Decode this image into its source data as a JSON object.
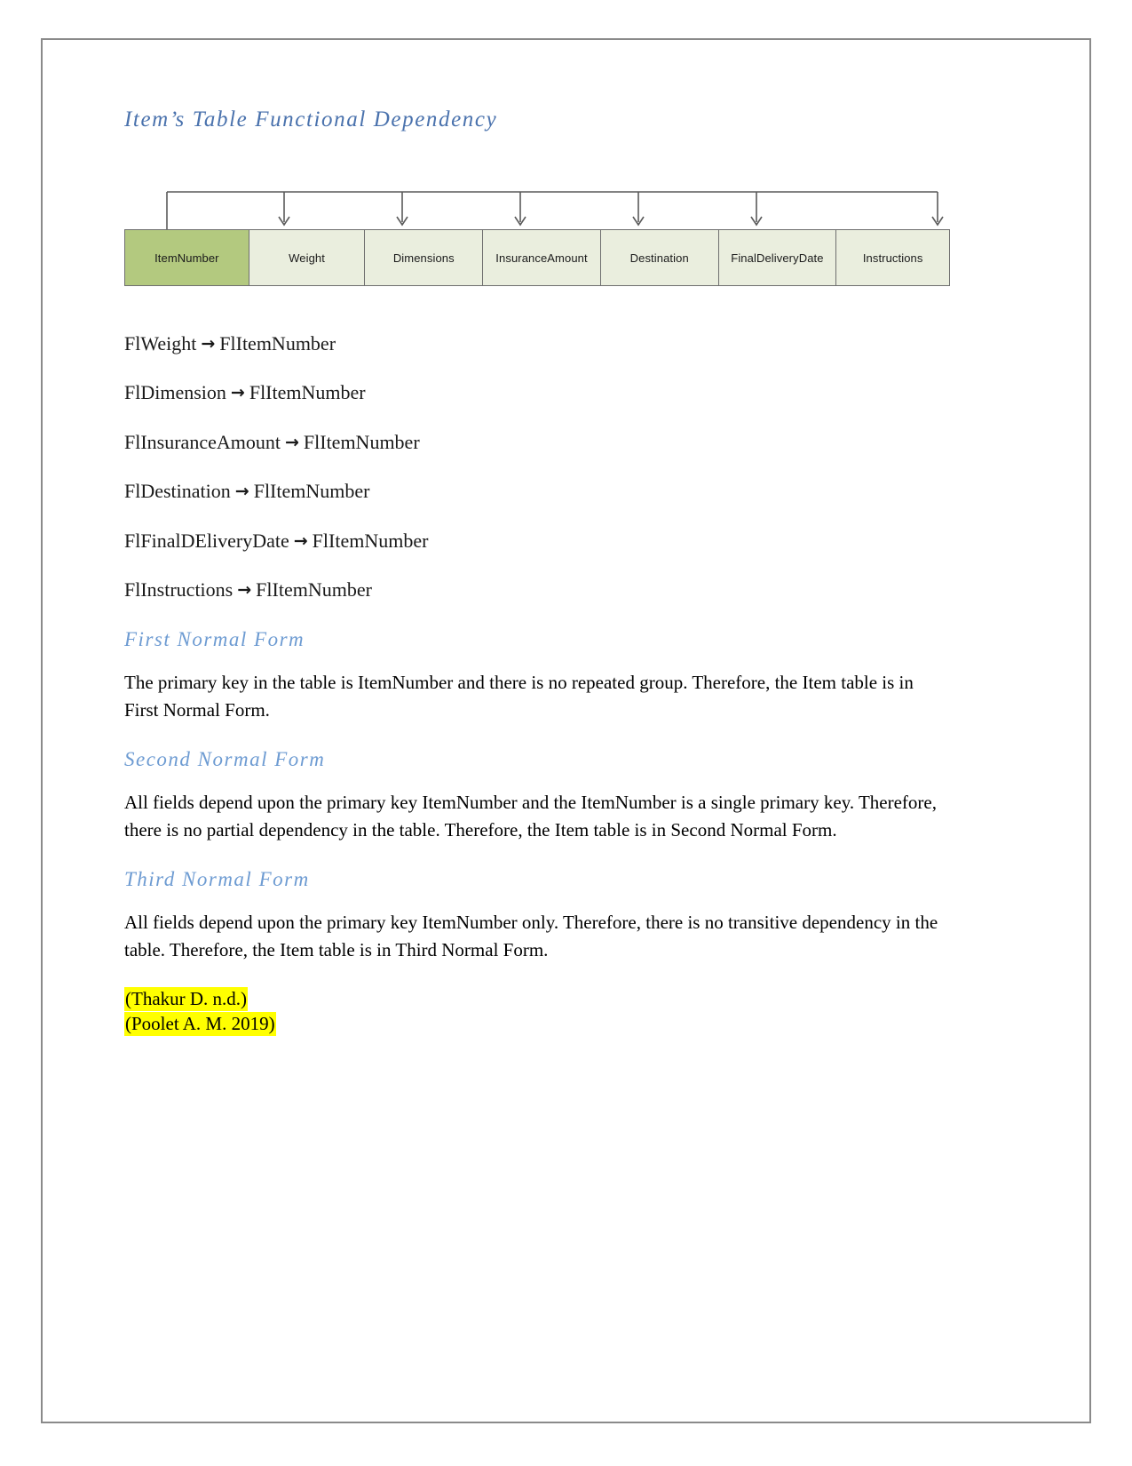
{
  "document": {
    "title": "Item’s Table Functional Dependency",
    "colors": {
      "heading_primary": "#4a72ad",
      "heading_secondary": "#6d9bd2",
      "pk_cell": "#b3c97f",
      "cell": "#eaeede",
      "cell_border": "#6f6f6f",
      "highlight": "#ffff00",
      "page_border": "#8a8a8a"
    }
  },
  "diagram": {
    "name": "item-table-functional-dependency-diagram",
    "cells": [
      {
        "label": "ItemNumber",
        "is_primary_key": true
      },
      {
        "label": "Weight",
        "is_primary_key": false
      },
      {
        "label": "Dimensions",
        "is_primary_key": false
      },
      {
        "label": "InsuranceAmount",
        "is_primary_key": false
      },
      {
        "label": "Destination",
        "is_primary_key": false
      },
      {
        "label": "FinalDeliveryDate",
        "is_primary_key": false
      },
      {
        "label": "Instructions",
        "is_primary_key": false
      }
    ]
  },
  "dependencies": [
    {
      "determinant": "FlWeight",
      "arrow": "→",
      "dependent": "FlItemNumber"
    },
    {
      "determinant": "FlDimension",
      "arrow": "→",
      "dependent": "FlItemNumber"
    },
    {
      "determinant": "FlInsuranceAmount",
      "arrow": "→",
      "dependent": "FlItemNumber"
    },
    {
      "determinant": "FlDestination",
      "arrow": "→",
      "dependent": "FlItemNumber"
    },
    {
      "determinant": "FlFinalDEliveryDate",
      "arrow": "→",
      "dependent": "FlItemNumber"
    },
    {
      "determinant": "FlInstructions",
      "arrow": "→",
      "dependent": "FlItemNumber"
    }
  ],
  "sections": [
    {
      "heading": "First Normal Form",
      "body": "The primary key in the table is ItemNumber and there is no repeated group. Therefore, the Item table is in First Normal Form."
    },
    {
      "heading": "Second Normal Form",
      "body": "All fields depend upon the primary key ItemNumber and the ItemNumber is a single primary key. Therefore, there is no partial dependency in the table. Therefore, the Item table is in Second Normal Form."
    },
    {
      "heading": "Third Normal Form",
      "body": "All fields depend upon the primary key ItemNumber only. Therefore, there is no transitive dependency in the table. Therefore, the Item table is in Third Normal Form."
    }
  ],
  "citations": [
    "(Thakur D. n.d.)",
    "(Poolet A. M. 2019)"
  ]
}
